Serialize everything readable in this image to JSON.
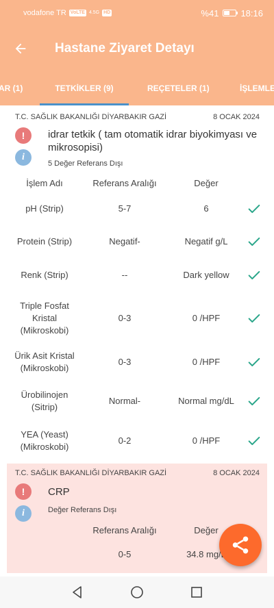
{
  "status_bar": {
    "carrier": "vodafone TR",
    "volte": "VoLTE",
    "signal": "4.5G",
    "hd": "HD",
    "battery_text": "%41",
    "battery_level": 0.41,
    "time": "18:16"
  },
  "header": {
    "title": "Hastane Ziyaret Detayı"
  },
  "tabs": [
    {
      "label": "AR (1)"
    },
    {
      "label": "TETKİKLER (9)"
    },
    {
      "label": "REÇETELER (1)"
    },
    {
      "label": "İŞLEMLER"
    }
  ],
  "colors": {
    "header_bg": "#fab68c",
    "tab_indicator": "#4a90c8",
    "check": "#2aa68a",
    "warn": "#e87a7a",
    "info": "#8bb8df",
    "alert_card": "#fde3e0",
    "fab": "#fd6a2c"
  },
  "cards": [
    {
      "institution": "T.C. SAĞLIK BAKANLIĞI DİYARBAKIR GAZİ",
      "date": "8 OCAK 2024",
      "test_name": "idrar tetkik ( tam otomatik idrar biyokimyası ve mikrosopisi)",
      "ref_status": "5 Değer Referans Dışı",
      "headers": {
        "name": "İşlem Adı",
        "range": "Referans Aralığı",
        "value": "Değer"
      },
      "rows": [
        {
          "name": "pH (Strip)",
          "range": "5-7",
          "value": "6"
        },
        {
          "name": "Protein (Strip)",
          "range": "Negatif-",
          "value": "Negatif g/L"
        },
        {
          "name": "Renk (Strip)",
          "range": "--",
          "value": "Dark yellow"
        },
        {
          "name": "Triple Fosfat Kristal (Mikroskobi)",
          "range": "0-3",
          "value": "0 /HPF"
        },
        {
          "name": "Ürik Asit Kristal (Mikroskobi)",
          "range": "0-3",
          "value": "0 /HPF"
        },
        {
          "name": "Ürobilinojen (Sitrip)",
          "range": "Normal-",
          "value": "Normal mg/dL"
        },
        {
          "name": "YEA (Yeast) (Mikroskobi)",
          "range": "0-2",
          "value": "0 /HPF"
        }
      ]
    },
    {
      "institution": "T.C. SAĞLIK BAKANLIĞI DİYARBAKIR GAZİ",
      "date": "8 OCAK 2024",
      "test_name": "CRP",
      "ref_status": "Değer Referans Dışı",
      "headers": {
        "range": "Referans Aralığı",
        "value": "Değer"
      },
      "rows": [
        {
          "range": "0-5",
          "value": "34.8 mg/L"
        }
      ]
    }
  ],
  "icons": {
    "back": "arrow-left-icon",
    "warning": "warning-icon",
    "info": "info-icon",
    "check": "check-icon",
    "share": "share-icon"
  }
}
